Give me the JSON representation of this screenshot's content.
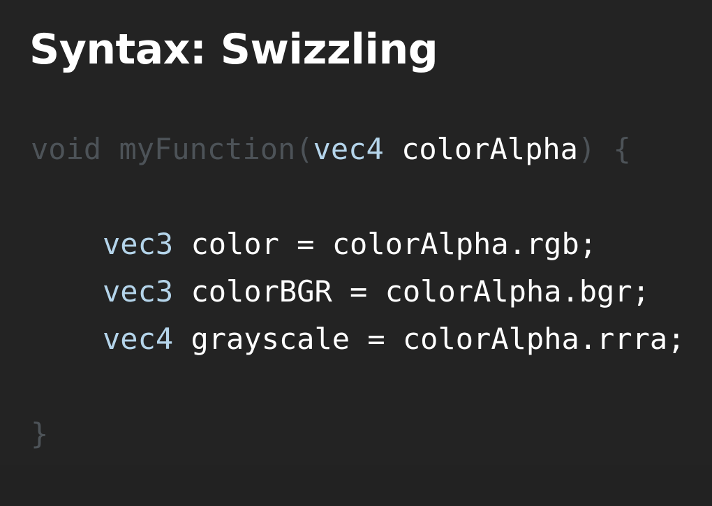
{
  "title": "Syntax: Swizzling",
  "code": {
    "signature": {
      "keyword": "void",
      "name": "myFunction",
      "open_paren": "(",
      "param_type": "vec4",
      "param_name": "colorAlpha",
      "close_paren": ")",
      "open_brace": "{"
    },
    "statements": [
      {
        "type": "vec3",
        "text": "color = colorAlpha.rgb;"
      },
      {
        "type": "vec3",
        "text": "colorBGR = colorAlpha.bgr;"
      },
      {
        "type": "vec4",
        "text": "grayscale = colorAlpha.rrra;"
      }
    ],
    "close_brace": "}"
  },
  "colors": {
    "background": "#232323",
    "title": "#ffffff",
    "dimmed_code": "#4d5358",
    "type_keyword": "#b4d4ea",
    "code_text": "#ffffff"
  }
}
